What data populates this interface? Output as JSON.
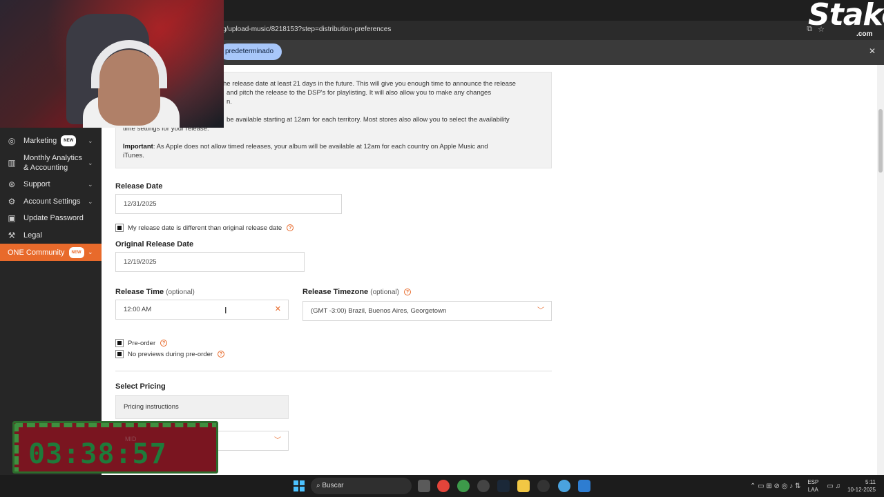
{
  "browser": {
    "url": "g/upload-music/8218153?step=distribution-preferences",
    "infobar_pill": "predeterminado",
    "logo": {
      "text": "Stake",
      "suffix": ".com"
    }
  },
  "sidebar": {
    "items": [
      {
        "label": "Marketing",
        "badge": "NEW",
        "icon": "target-icon"
      },
      {
        "label": "Monthly Analytics & Accounting",
        "icon": "chart-icon"
      },
      {
        "label": "Support",
        "icon": "support-icon"
      },
      {
        "label": "Account Settings",
        "icon": "gear-icon"
      },
      {
        "label": "Update Password",
        "icon": "lock-icon"
      },
      {
        "label": "Legal",
        "icon": "gavel-icon"
      },
      {
        "label": "ONE Community",
        "badge": "NEW",
        "icon": "community-icon"
      }
    ]
  },
  "notice": {
    "p1": "he release date at least 21 days in the future. This will give you enough time to announce the release",
    "p1b": "and pitch the release to the DSP's for playlisting. It will also allow you to make any changes",
    "p1c": "n.",
    "p2": "be available starting at 12am for each territory. Most stores also allow you to select the availability",
    "p2b": "time settings for your release.",
    "important_label": "Important",
    "important_text": ": As Apple does not allow timed releases, your album will be available at 12am for each country on Apple Music and",
    "important_text2": "iTunes."
  },
  "form": {
    "release_date_label": "Release Date",
    "release_date_value": "12/31/2025",
    "different_date_checkbox": "My release date is different than original release date",
    "original_date_label": "Original Release Date",
    "original_date_value": "12/19/2025",
    "release_time_label": "Release Time",
    "optional": "(optional)",
    "release_time_value": "12:00 AM",
    "timezone_label": "Release Timezone",
    "timezone_value": "(GMT -3:00) Brazil, Buenos Aires, Georgetown",
    "preorder": "Pre-order",
    "no_previews": "No previews during pre-order",
    "select_pricing_label": "Select Pricing",
    "pricing_instructions": "Pricing instructions",
    "pricing_value": "MID"
  },
  "timer": {
    "value": "03:38:57"
  },
  "taskbar": {
    "search": "Buscar",
    "lang_top": "ESP",
    "lang_bottom": "LAA",
    "time": "5:11",
    "date": "10-12-2025"
  },
  "colors": {
    "accent": "#e86a2b",
    "sidebar_bg": "#262626",
    "pill": "#a8c7fa"
  }
}
